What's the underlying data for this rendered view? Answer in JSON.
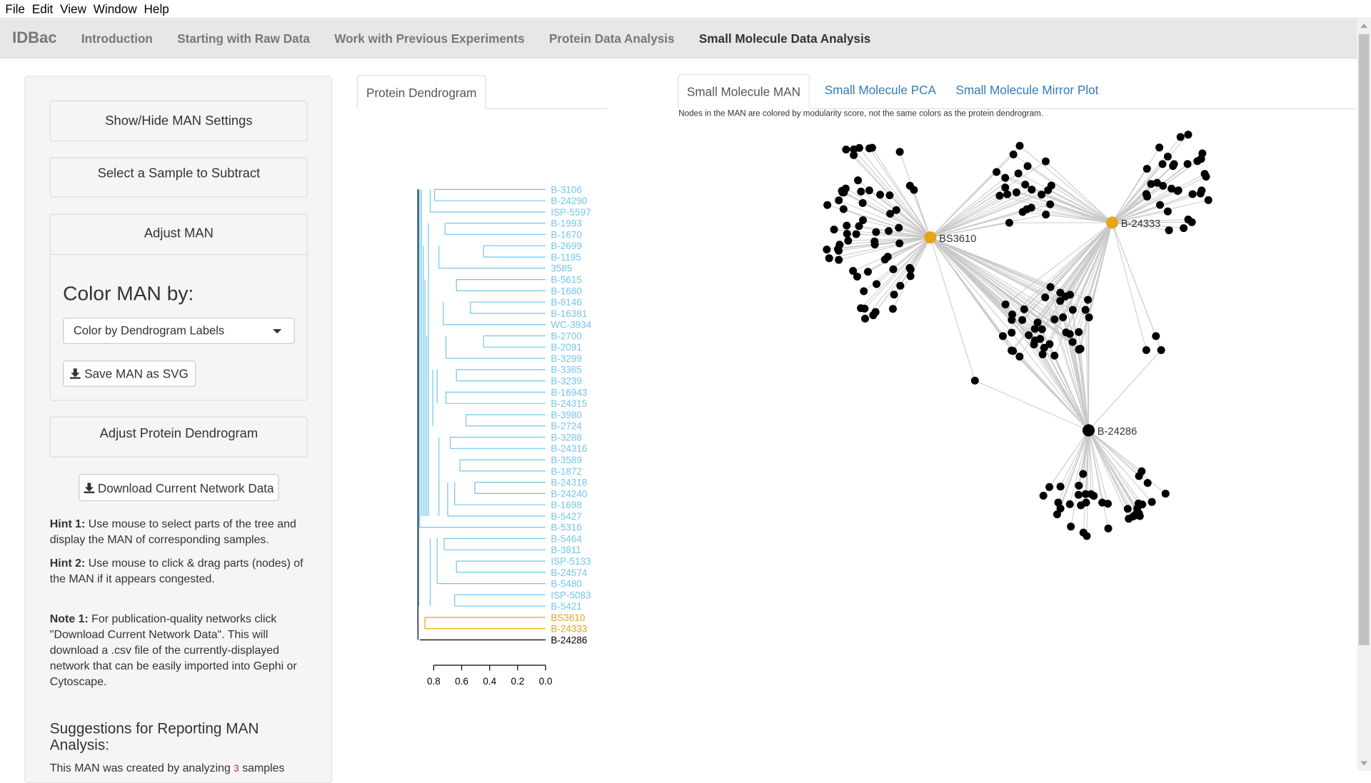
{
  "menu": [
    "File",
    "Edit",
    "View",
    "Window",
    "Help"
  ],
  "nav": {
    "brand": "IDBac",
    "links": [
      "Introduction",
      "Starting with Raw Data",
      "Work with Previous Experiments",
      "Protein Data Analysis",
      "Small Molecule Data Analysis"
    ]
  },
  "sidebar": {
    "show_hide": "Show/Hide MAN Settings",
    "select_sample": "Select a Sample to Subtract",
    "adjust_man": "Adjust MAN",
    "color_man_by": "Color MAN by:",
    "color_select_value": "Color by Dendrogram Labels",
    "save_svg": "Save MAN as SVG",
    "adjust_dendro": "Adjust Protein Dendrogram",
    "download_network": "Download Current Network Data",
    "hint1_label": "Hint 1:",
    "hint1_text": " Use mouse to select parts of the tree and display the MAN of corresponding samples.",
    "hint2_label": "Hint 2:",
    "hint2_text": " Use mouse to click & drag parts (nodes) of the MAN if it appears congested.",
    "note1_label": "Note 1:",
    "note1_text": " For publication-quality networks click \"Download Current Network Data\". This will download a .csv file of the currently-displayed network that can be easily imported into Gephi or Cytoscape.",
    "suggest_title": "Suggestions for Reporting MAN Analysis:",
    "suggest_text_a": "This MAN was created by analyzing ",
    "suggest_count": "3",
    "suggest_text_b": " samples"
  },
  "tabs": {
    "dendro_tab": "Protein Dendrogram",
    "man_tabs": [
      "Small Molecule MAN",
      "Small Molecule PCA",
      "Small Molecule Mirror Plot"
    ]
  },
  "man_note": "Nodes in the MAN are colored by modularity score, not the same colors as the protein dendrogram.",
  "colors": {
    "blue": "#74c5ea",
    "orange": "#e8a317",
    "black": "#000000",
    "link": "#337ab7"
  },
  "dendrogram": {
    "axis_ticks": [
      "0.8",
      "0.6",
      "0.4",
      "0.2",
      "0.0"
    ],
    "leaves": [
      {
        "label": "B-3106",
        "color": "blue"
      },
      {
        "label": "B-24290",
        "color": "blue"
      },
      {
        "label": "ISP-5597",
        "color": "blue"
      },
      {
        "label": "B-1993",
        "color": "blue"
      },
      {
        "label": "B-1670",
        "color": "blue"
      },
      {
        "label": "B-2699",
        "color": "blue"
      },
      {
        "label": "B-1195",
        "color": "blue"
      },
      {
        "label": "3585",
        "color": "blue"
      },
      {
        "label": "B-5615",
        "color": "blue"
      },
      {
        "label": "B-1680",
        "color": "blue"
      },
      {
        "label": "B-8146",
        "color": "blue"
      },
      {
        "label": "B-16381",
        "color": "blue"
      },
      {
        "label": "WC-3934",
        "color": "blue"
      },
      {
        "label": "B-2700",
        "color": "blue"
      },
      {
        "label": "B-2091",
        "color": "blue"
      },
      {
        "label": "B-3299",
        "color": "blue"
      },
      {
        "label": "B-3365",
        "color": "blue"
      },
      {
        "label": "B-3239",
        "color": "blue"
      },
      {
        "label": "B-16943",
        "color": "blue"
      },
      {
        "label": "B-24315",
        "color": "blue"
      },
      {
        "label": "B-3980",
        "color": "blue"
      },
      {
        "label": "B-2724",
        "color": "blue"
      },
      {
        "label": "B-3288",
        "color": "blue"
      },
      {
        "label": "B-24316",
        "color": "blue"
      },
      {
        "label": "B-3589",
        "color": "blue"
      },
      {
        "label": "B-1872",
        "color": "blue"
      },
      {
        "label": "B-24318",
        "color": "blue"
      },
      {
        "label": "B-24240",
        "color": "blue"
      },
      {
        "label": "B-1698",
        "color": "blue"
      },
      {
        "label": "B-5427",
        "color": "blue"
      },
      {
        "label": "B-5316",
        "color": "blue"
      },
      {
        "label": "B-5464",
        "color": "blue"
      },
      {
        "label": "B-3811",
        "color": "blue"
      },
      {
        "label": "ISP-5133",
        "color": "blue"
      },
      {
        "label": "B-24574",
        "color": "blue"
      },
      {
        "label": "B-5480",
        "color": "blue"
      },
      {
        "label": "ISP-5083",
        "color": "blue"
      },
      {
        "label": "B-5421",
        "color": "blue"
      },
      {
        "label": "BS3610",
        "color": "orange"
      },
      {
        "label": "B-24333",
        "color": "orange"
      },
      {
        "label": "B-24286",
        "color": "black"
      }
    ]
  },
  "network": {
    "hubs": [
      {
        "label": "BS3610",
        "color": "orange"
      },
      {
        "label": "B-24333",
        "color": "orange"
      },
      {
        "label": "B-24286",
        "color": "black"
      }
    ]
  }
}
